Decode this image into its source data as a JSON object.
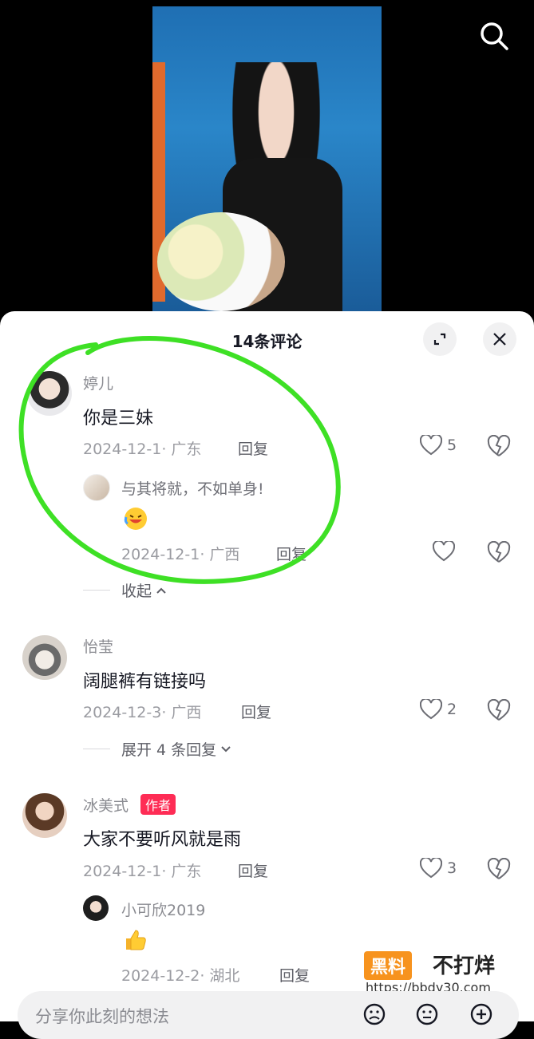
{
  "comments_panel": {
    "title": "14条评论"
  },
  "comments": [
    {
      "user": "婷儿",
      "text": "你是三妹",
      "date_location": "2024-12-1· 广东",
      "reply_label": "回复",
      "likes": "5",
      "replies": [
        {
          "text": "与其将就，不如单身!",
          "emoji": "laughing-crying-emoji",
          "date_location": "2024-12-1· 广西",
          "reply_label": "回复"
        }
      ],
      "collapse_label": "收起"
    },
    {
      "user": "怡莹",
      "text": "阔腿裤有链接吗",
      "date_location": "2024-12-3· 广西",
      "reply_label": "回复",
      "likes": "2",
      "expand_label": "展开 4 条回复"
    },
    {
      "user": "冰美式",
      "badge": "作者",
      "text": "大家不要听风就是雨",
      "date_location": "2024-12-1· 广东",
      "reply_label": "回复",
      "likes": "3",
      "replies": [
        {
          "user": "小可欣2019",
          "emoji": "thumbs-up-emoji",
          "date_location": "2024-12-2· 湖北",
          "reply_label": "回复"
        }
      ]
    }
  ],
  "input": {
    "placeholder": "分享你此刻的想法"
  },
  "watermark": {
    "box": "黑料",
    "text": "不打烊",
    "url": "https://bbdy30.com"
  },
  "colors": {
    "accent": "#fe2c55",
    "highlight": "#3ee025",
    "sheet": "#ffffff"
  }
}
